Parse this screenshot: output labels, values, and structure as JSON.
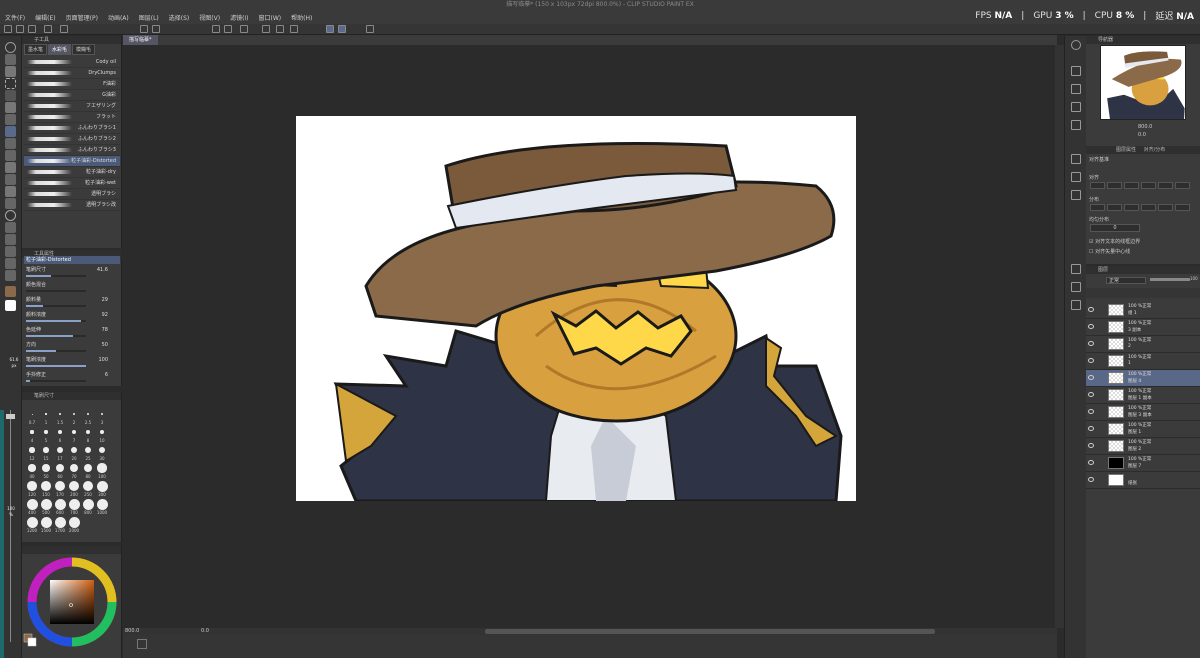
{
  "app": {
    "title": "描写临摹* (150 x 103px 72dpi 800.0%) - CLIP STUDIO PAINT EX"
  },
  "menu": [
    "文件(F)",
    "编辑(E)",
    "页面管理(P)",
    "动画(A)",
    "图层(L)",
    "选择(S)",
    "视图(V)",
    "滤镜(I)",
    "窗口(W)",
    "帮助(H)"
  ],
  "perf": {
    "fps_label": "FPS",
    "fps_value": "N/A",
    "gpu_label": "GPU",
    "gpu_value": "3 %",
    "cpu_label": "CPU",
    "cpu_value": "8 %",
    "lat_label": "延迟",
    "lat_value": "N/A"
  },
  "doc_tab": "描写临摹*",
  "subtool": {
    "title": "子工具",
    "tabs": [
      "墨水笔",
      "水彩毛",
      "模糊毛"
    ],
    "active_tab": 1,
    "brushes": [
      "Cody oil",
      "DryClumps",
      "F油彩",
      "G油彩",
      "フエザリング",
      "フラット",
      "ふんわりブラシ1",
      "ふんわりブラシ2",
      "ふんわりブラシ3",
      "粒子油彩-Distorted",
      "粒子油彩-dry",
      "粒子油彩-wet",
      "透明ブラシ",
      "透明ブラシ改"
    ],
    "selected_index": 9
  },
  "toolprop": {
    "title": "工具属性",
    "brush_name": "粒子油彩-Distorted",
    "rows": [
      {
        "label": "笔刷尺寸",
        "value": "41.6",
        "fill": 0.42
      },
      {
        "label": "颜色混合",
        "value": "",
        "fill": 0
      },
      {
        "label": "颜料量",
        "value": "29",
        "fill": 0.29
      },
      {
        "label": "颜料浓度",
        "value": "92",
        "fill": 0.92
      },
      {
        "label": "色延伸",
        "value": "78",
        "fill": 0.78
      },
      {
        "label": "方向",
        "value": "50",
        "fill": 0.5
      },
      {
        "label": "笔刷浓度",
        "value": "100",
        "fill": 1.0
      },
      {
        "label": "手抖修正",
        "value": "6",
        "fill": 0.06
      }
    ]
  },
  "brushsize": {
    "title": "笔刷尺寸",
    "sizes": [
      "0.7",
      "1",
      "1.5",
      "2",
      "2.5",
      "3",
      "4",
      "5",
      "6",
      "7",
      "8",
      "10",
      "12",
      "15",
      "17",
      "20",
      "25",
      "30",
      "40",
      "50",
      "60",
      "70",
      "80",
      "100",
      "120",
      "150",
      "170",
      "200",
      "250",
      "300",
      "400",
      "500",
      "600",
      "700",
      "800",
      "1000",
      "1200",
      "1500",
      "1700",
      "2000"
    ]
  },
  "sizebar": {
    "value": "61.6",
    "unit": "px"
  },
  "opacitybar": {
    "value": "100",
    "unit": "%"
  },
  "status": {
    "zoom": "800.0",
    "angle": "0.0"
  },
  "navigator": {
    "title": "导航器",
    "zoom": "800.0",
    "angle": "0.0"
  },
  "align": {
    "title": "对齐/分布",
    "tabs": [
      "图层属性",
      "对齐/分布"
    ],
    "target_label": "对齐基准",
    "sections": [
      "对齐",
      "分布",
      "均匀分布"
    ],
    "spacing_value": "0",
    "check1": "对齐文本的线框边界",
    "check2": "对齐矢量中心线"
  },
  "layers": {
    "title": "图层",
    "blend_mode": "正常",
    "opacity": "100",
    "items": [
      {
        "line1": "100 %正常",
        "line2": "组 1"
      },
      {
        "line1": "100 %正常",
        "line2": "3 副本"
      },
      {
        "line1": "100 %正常",
        "line2": "2"
      },
      {
        "line1": "100 %正常",
        "line2": "1"
      },
      {
        "line1": "100 %正常",
        "line2": "图层 4"
      },
      {
        "line1": "100 %正常",
        "line2": "图层 1 副本"
      },
      {
        "line1": "100 %正常",
        "line2": "图层 3 副本"
      },
      {
        "line1": "100 %正常",
        "line2": "图层 1"
      },
      {
        "line1": "100 %正常",
        "line2": "图层 2"
      },
      {
        "line1": "100 %正常",
        "line2": "图层 7"
      },
      {
        "line1": "",
        "line2": "纸张"
      }
    ],
    "selected_index": 4
  }
}
